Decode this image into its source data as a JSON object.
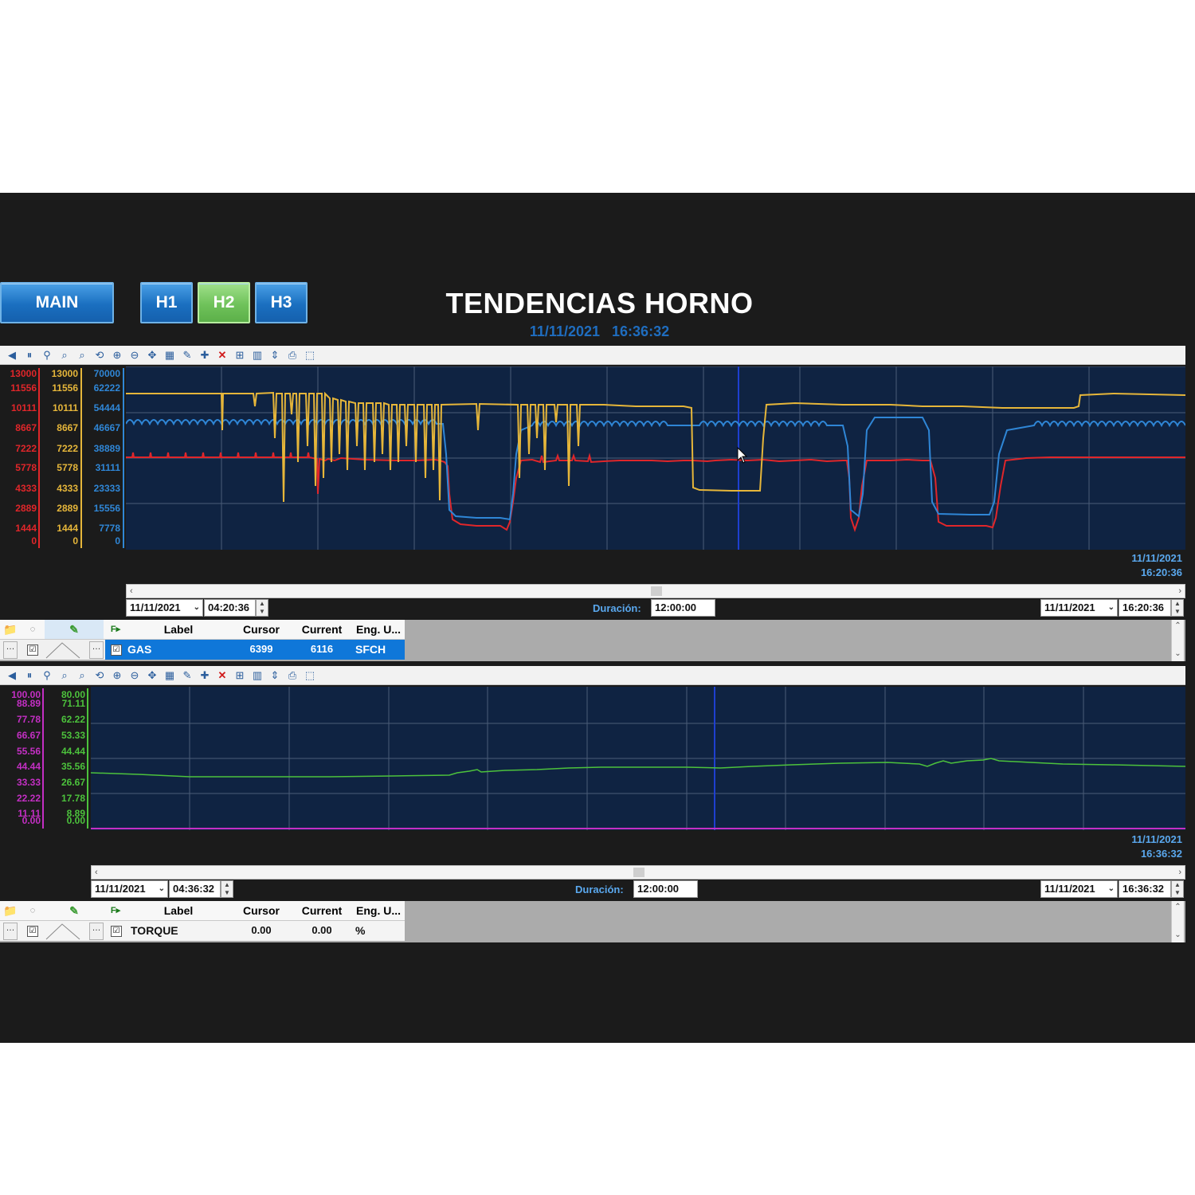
{
  "nav": {
    "main": "MAIN",
    "h1": "H1",
    "h2": "H2",
    "h3": "H3"
  },
  "header": {
    "title": "TENDENCIAS HORNO",
    "date": "11/11/2021",
    "time": "16:36:32"
  },
  "trend1": {
    "axis_red": [
      "13000",
      "11556",
      "10111",
      "8667",
      "7222",
      "5778",
      "4333",
      "2889",
      "1444",
      "0"
    ],
    "axis_yellow": [
      "13000",
      "11556",
      "10111",
      "8667",
      "7222",
      "5778",
      "4333",
      "2889",
      "1444",
      "0"
    ],
    "axis_blue": [
      "70000",
      "62222",
      "54444",
      "46667",
      "38889",
      "31111",
      "23333",
      "15556",
      "7778",
      "0"
    ],
    "end_date": "11/11/2021",
    "end_time": "16:20:36",
    "start_date": "11/11/2021",
    "start_time": "04:20:36",
    "duration_label": "Duración:",
    "duration": "12:00:00",
    "right_date": "11/11/2021",
    "right_time": "16:20:36",
    "grid_headers": {
      "label": "Label",
      "cursor": "Cursor",
      "current": "Current",
      "eng": "Eng. U..."
    },
    "row": {
      "label": "GAS",
      "cursor": "6399",
      "current": "6116",
      "eng": "SFCH"
    },
    "colors": {
      "red": "#e0262a",
      "yellow": "#e6b63a",
      "blue": "#2f86d6"
    }
  },
  "trend2": {
    "axis_magenta": [
      "100.00",
      "88.89",
      "77.78",
      "66.67",
      "55.56",
      "44.44",
      "33.33",
      "22.22",
      "11.11",
      "0.00"
    ],
    "axis_green": [
      "80.00",
      "71.11",
      "62.22",
      "53.33",
      "44.44",
      "35.56",
      "26.67",
      "17.78",
      "8.89",
      "0.00"
    ],
    "end_date": "11/11/2021",
    "end_time": "16:36:32",
    "start_date": "11/11/2021",
    "start_time": "04:36:32",
    "duration_label": "Duración:",
    "duration": "12:00:00",
    "right_date": "11/11/2021",
    "right_time": "16:36:32",
    "grid_headers": {
      "label": "Label",
      "cursor": "Cursor",
      "current": "Current",
      "eng": "Eng. U..."
    },
    "row": {
      "label": "TORQUE",
      "cursor": "0.00",
      "current": "0.00",
      "eng": "%"
    },
    "colors": {
      "green": "#4cc23c",
      "magenta": "#c42fc4"
    }
  }
}
